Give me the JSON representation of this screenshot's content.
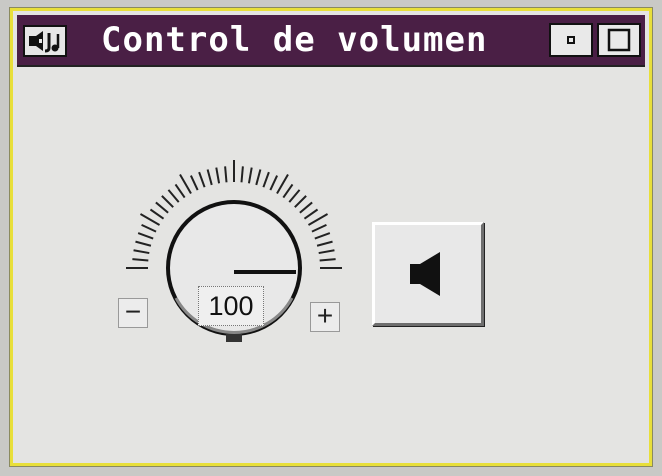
{
  "window": {
    "title": "Control de volumen"
  },
  "volume": {
    "value": "100",
    "decrease_label": "−",
    "increase_label": "+"
  },
  "icons": {
    "system_menu": "speaker-app-icon",
    "minimize": "minimize-icon",
    "maximize": "maximize-icon",
    "mute": "speaker-icon"
  },
  "colors": {
    "titlebar": "#4a1f45",
    "window_border": "#e8df3a",
    "face": "#e4e4e2"
  }
}
